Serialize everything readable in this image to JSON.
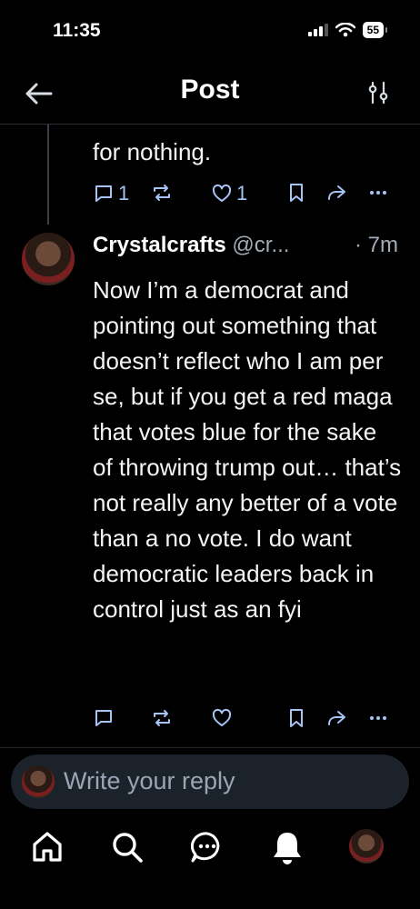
{
  "status_bar": {
    "time": "11:35",
    "battery": "55"
  },
  "header": {
    "title": "Post"
  },
  "previous_post": {
    "text_fragment": "for nothing.",
    "reply_count": "1",
    "like_count": "1"
  },
  "post": {
    "author": "Crystalcrafts",
    "handle": "@cr...",
    "time": "· 7m",
    "text": "Now I’m a democrat and pointing out something that doesn’t reflect who I am per se, but if you get a red maga that votes blue for the sake of throwing trump out… that’s not really any better of a vote than a no vote. I do want democratic leaders back in control just as an fyi"
  },
  "reply_box": {
    "placeholder": "Write your reply"
  },
  "colors": {
    "background": "#000000",
    "accent": "#a6c4f5",
    "muted": "#a3adb8"
  },
  "icons": [
    "back-arrow-icon",
    "filter-icon",
    "reply-icon",
    "repost-icon",
    "like-icon",
    "bookmark-icon",
    "share-icon",
    "more-icon",
    "home-icon",
    "search-icon",
    "chat-icon",
    "bell-icon"
  ]
}
